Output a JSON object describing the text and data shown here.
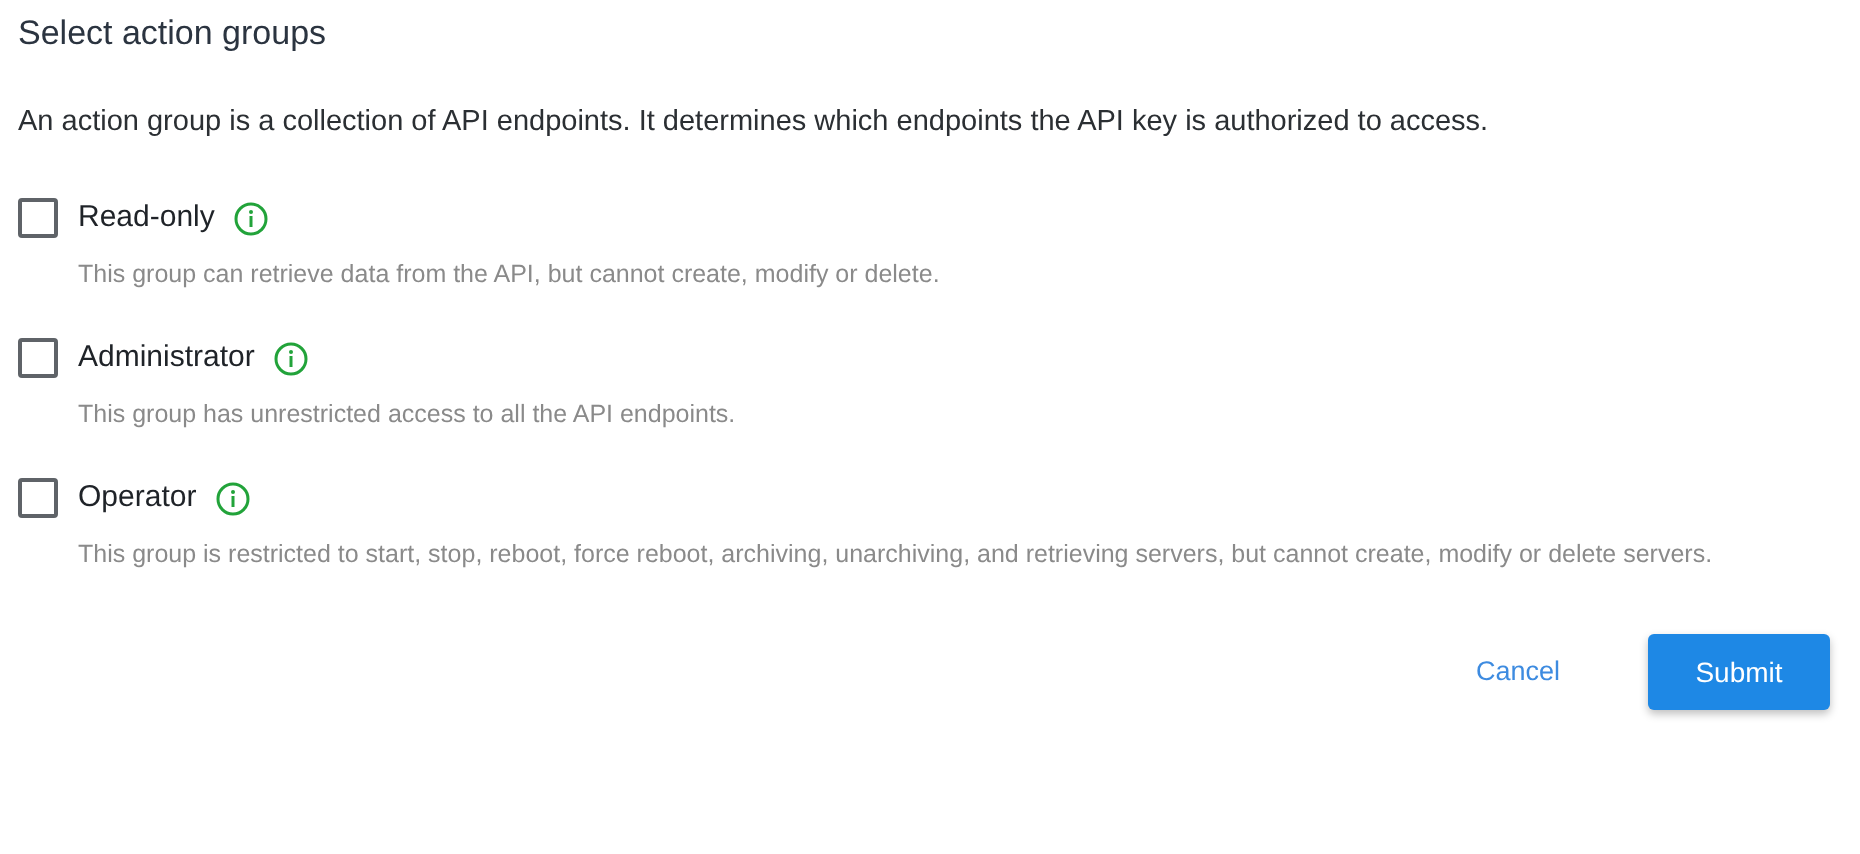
{
  "title": "Select action groups",
  "description": "An action group is a collection of API endpoints. It determines which endpoints the API key is authorized to access.",
  "groups": [
    {
      "label": "Read-only",
      "checked": false,
      "description": "This group can retrieve data from the API, but cannot create, modify or delete."
    },
    {
      "label": "Administrator",
      "checked": false,
      "description": "This group has unrestricted access to all the API endpoints."
    },
    {
      "label": "Operator",
      "checked": false,
      "description": "This group is restricted to start, stop, reboot, force reboot, archiving, unarchiving, and retrieving servers, but cannot create, modify or delete servers."
    }
  ],
  "buttons": {
    "cancel": "Cancel",
    "submit": "Submit"
  }
}
